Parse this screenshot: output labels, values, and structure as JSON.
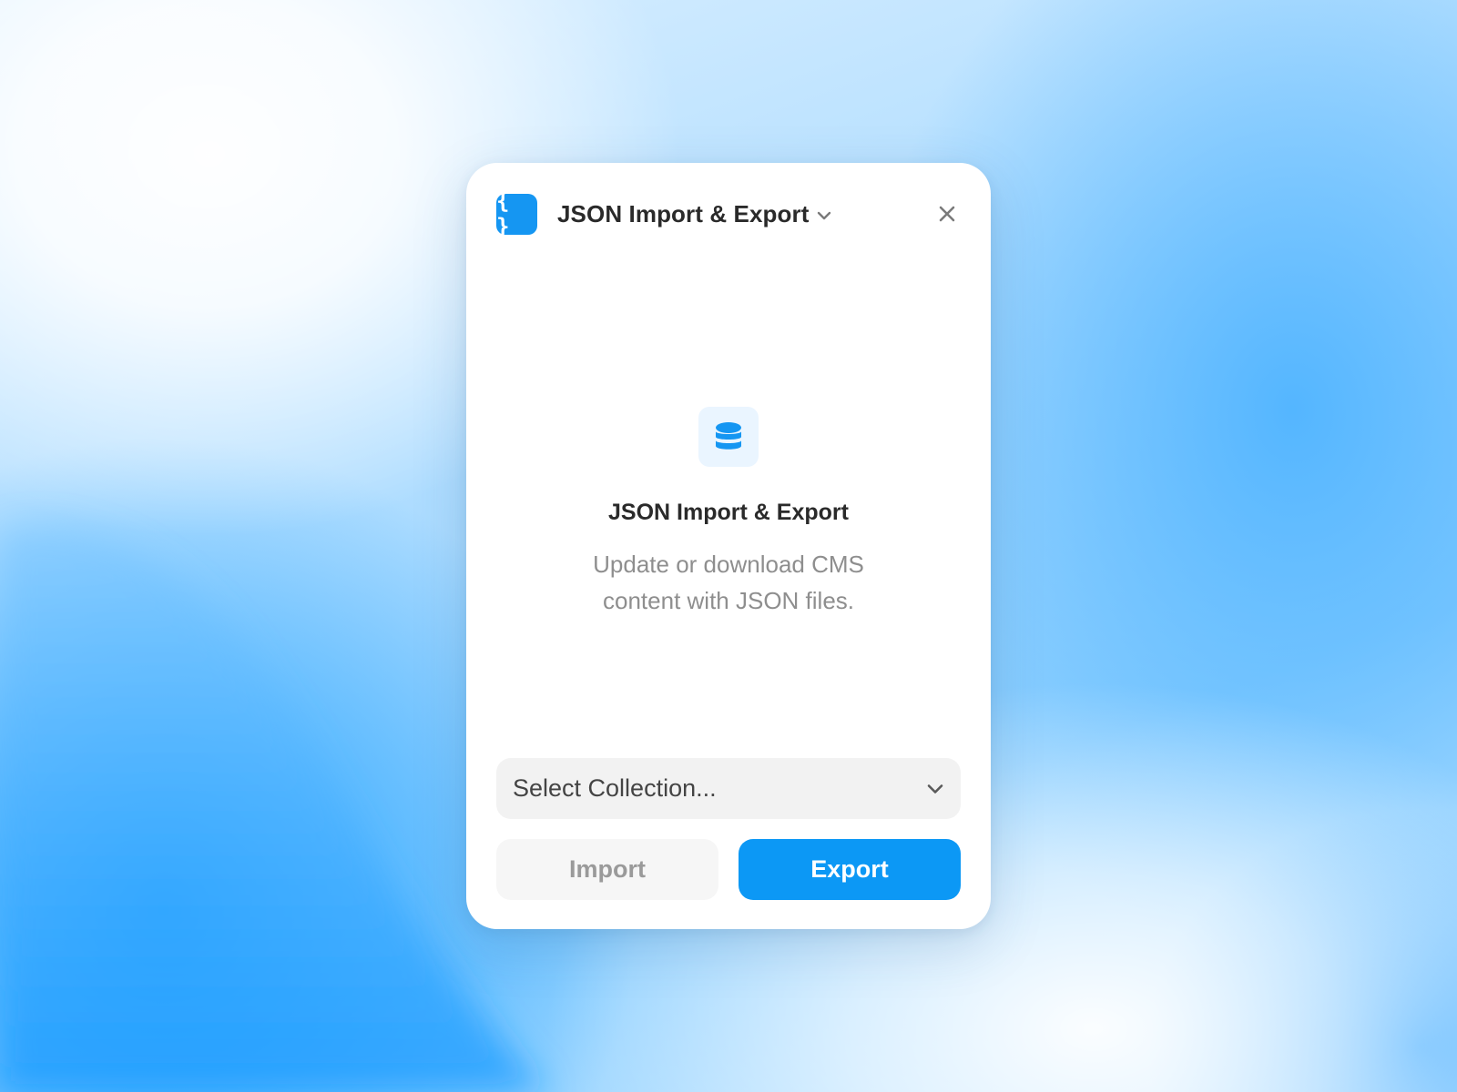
{
  "plugin": {
    "app_icon_glyph": "{ }",
    "app_icon_name": "json-braces-icon",
    "title": "JSON Import & Export",
    "close_icon": "close-icon"
  },
  "empty_state": {
    "icon": "database-icon",
    "heading": "JSON Import & Export",
    "description": "Update or download CMS content with JSON files."
  },
  "collection_select": {
    "selected": "Select Collection..."
  },
  "actions": {
    "import_label": "Import",
    "export_label": "Export"
  },
  "colors": {
    "accent": "#0c98f5",
    "icon_bg": "#1596f2",
    "icon_soft_bg": "#eaf5ff"
  }
}
